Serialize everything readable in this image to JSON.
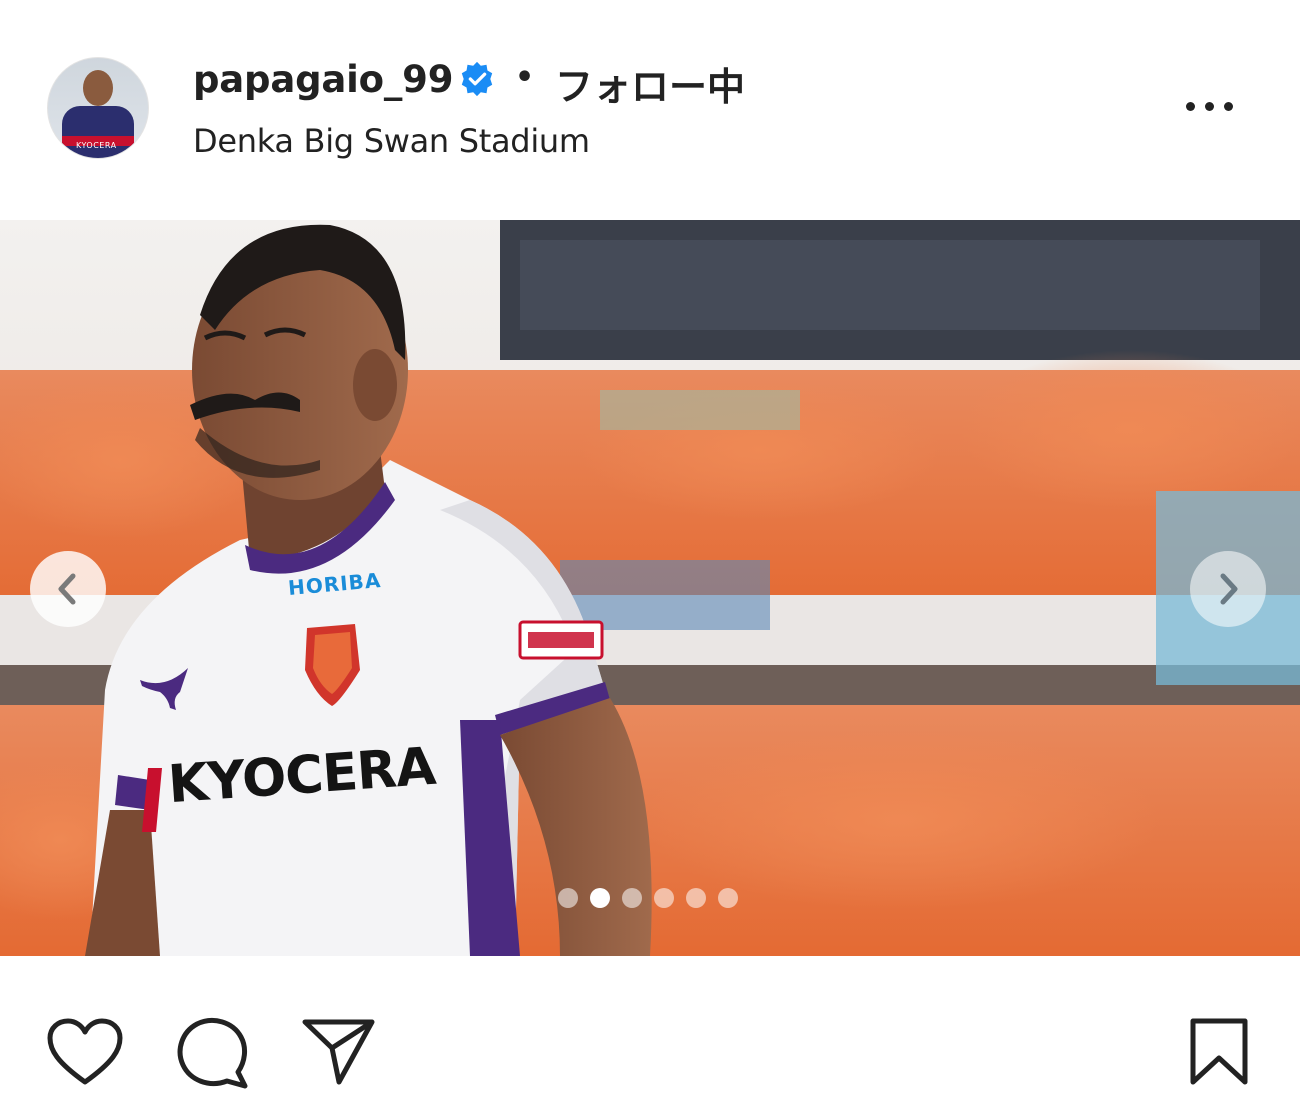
{
  "header": {
    "username": "papagaio_99",
    "separator": "•",
    "follow_status": "フォロー中",
    "location": "Denka Big Swan Stadium",
    "avatar_jersey_text": "KYOCERA"
  },
  "photo": {
    "jersey_sponsor": "KYOCERA",
    "sleeve_sponsor": "HORIBA",
    "carousel_total": 6,
    "carousel_active_index": 1
  },
  "icons": {
    "verified": "verified-badge-icon",
    "more": "more-options-icon",
    "prev": "chevron-left-icon",
    "next": "chevron-right-icon",
    "like": "heart-icon",
    "comment": "comment-icon",
    "share": "send-icon",
    "save": "bookmark-icon"
  },
  "colors": {
    "verified_blue": "#1a8cf5",
    "crowd_orange": "#e8703a",
    "jersey_white": "#f4f4f6",
    "jersey_purple": "#4b2a80"
  }
}
